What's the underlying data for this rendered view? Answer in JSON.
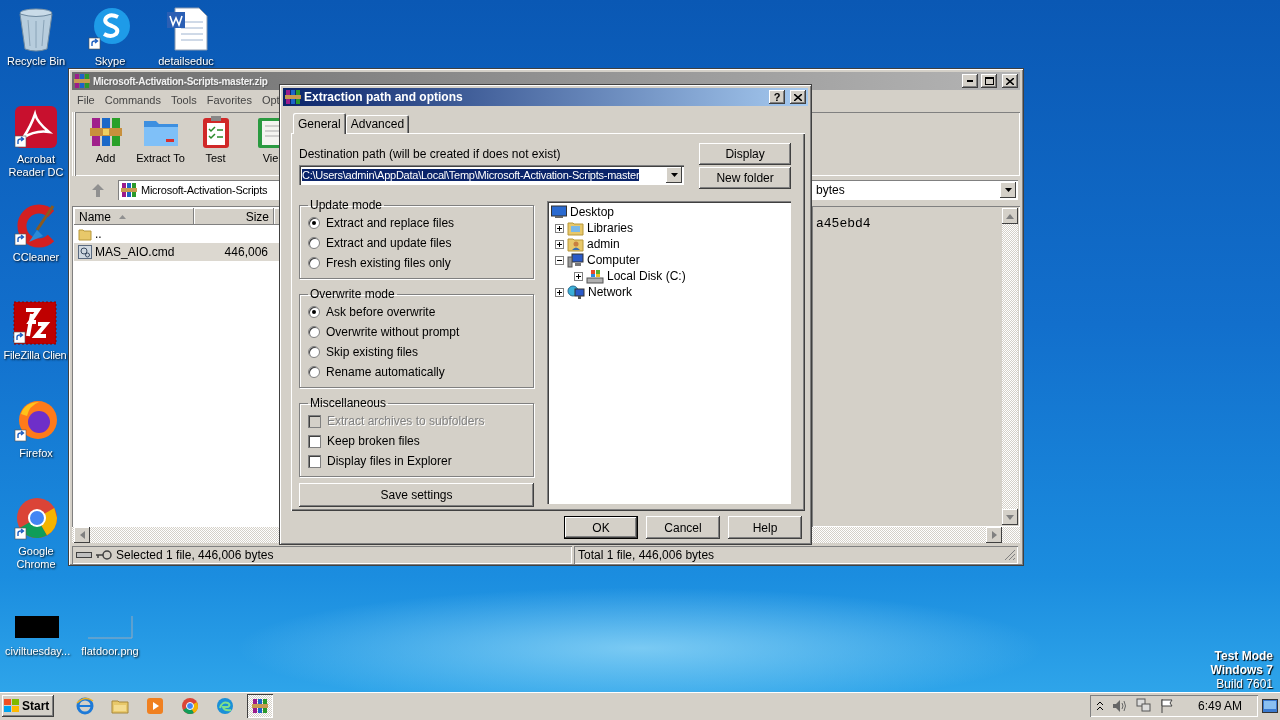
{
  "desktop_icons": [
    {
      "label": "Recycle Bin",
      "kind": "recycle"
    },
    {
      "label": "Skype",
      "kind": "skype"
    },
    {
      "label": "detailseduc",
      "kind": "word"
    },
    {
      "label": "Acrobat Reader DC",
      "kind": "acrobat"
    },
    {
      "label": "CCleaner",
      "kind": "ccleaner"
    },
    {
      "label": "FileZilla Clien",
      "kind": "filezilla"
    },
    {
      "label": "Firefox",
      "kind": "firefox"
    },
    {
      "label": "Google Chrome",
      "kind": "chrome"
    },
    {
      "label": "civiltuesday...",
      "kind": "black_image"
    },
    {
      "label": "flatdoor.png",
      "kind": "blank_image"
    }
  ],
  "winrar": {
    "title": "Microsoft-Activation-Scripts-master.zip",
    "active": false,
    "menu": [
      "File",
      "Commands",
      "Tools",
      "Favorites",
      "Opt"
    ],
    "toolbar": [
      {
        "label": "Add",
        "kind": "add"
      },
      {
        "label": "Extract To",
        "kind": "extract"
      },
      {
        "label": "Test",
        "kind": "test"
      },
      {
        "label": "Vie",
        "kind": "view"
      }
    ],
    "address": "Microsoft-Activation-Scripts",
    "address_tail": "bytes",
    "columns": [
      "Name",
      "Size"
    ],
    "rows": [
      {
        "name": "..",
        "kind": "folder",
        "selected": false
      },
      {
        "name": "MAS_AIO.cmd",
        "size": "446,006",
        "kind": "file",
        "selected": true
      }
    ],
    "info": "a45ebd4",
    "status_left": "Selected 1 file, 446,006 bytes",
    "status_right": "Total 1 file, 446,006 bytes"
  },
  "dialog": {
    "title": "Extraction path and options",
    "help_button": "?",
    "tabs": [
      {
        "label": "General",
        "selected": true
      },
      {
        "label": "Advanced",
        "selected": false
      }
    ],
    "path_label": "Destination path (will be created if does not exist)",
    "path": {
      "value": "C:\\Users\\admin\\AppData\\Local\\Temp\\Microsoft-Activation-Scripts-master",
      "selected": true
    },
    "side_buttons": [
      "Display",
      "New folder"
    ],
    "groups": [
      {
        "title": "Update mode",
        "kind": "radio",
        "options": [
          {
            "label": "Extract and replace files",
            "selected": true
          },
          {
            "label": "Extract and update files",
            "selected": false
          },
          {
            "label": "Fresh existing files only",
            "selected": false
          }
        ]
      },
      {
        "title": "Overwrite mode",
        "kind": "radio",
        "options": [
          {
            "label": "Ask before overwrite",
            "selected": true
          },
          {
            "label": "Overwrite without prompt",
            "selected": false
          },
          {
            "label": "Skip existing files",
            "selected": false
          },
          {
            "label": "Rename automatically",
            "selected": false
          }
        ]
      },
      {
        "title": "Miscellaneous",
        "kind": "checkbox",
        "options": [
          {
            "label": "Extract archives to subfolders",
            "checked": false,
            "disabled": true
          },
          {
            "label": "Keep broken files",
            "checked": false,
            "disabled": false
          },
          {
            "label": "Display files in Explorer",
            "checked": false,
            "disabled": false
          }
        ]
      }
    ],
    "save_button": "Save settings",
    "tree": [
      {
        "label": "Desktop",
        "kind": "desktop",
        "children": [
          {
            "label": "Libraries",
            "kind": "libraries",
            "expanded": false
          },
          {
            "label": "admin",
            "kind": "user",
            "expanded": false
          },
          {
            "label": "Computer",
            "kind": "computer",
            "expanded": true,
            "children": [
              {
                "label": "Local Disk (C:)",
                "kind": "disk",
                "expanded": false
              }
            ]
          },
          {
            "label": "Network",
            "kind": "network",
            "expanded": false
          }
        ]
      }
    ],
    "buttons": [
      {
        "label": "OK",
        "default": true
      },
      {
        "label": "Cancel",
        "default": false
      },
      {
        "label": "Help",
        "default": false
      }
    ]
  },
  "taskbar": {
    "start": "Start",
    "apps": [
      {
        "kind": "ie",
        "active": false
      },
      {
        "kind": "explorer",
        "active": false
      },
      {
        "kind": "media",
        "active": false
      },
      {
        "kind": "chrome",
        "active": false
      },
      {
        "kind": "edge",
        "active": false
      },
      {
        "kind": "winrar",
        "active": true
      }
    ],
    "clock": "6:49 AM"
  },
  "test_mode": [
    "Test Mode",
    "Windows 7",
    "Build 7601"
  ]
}
